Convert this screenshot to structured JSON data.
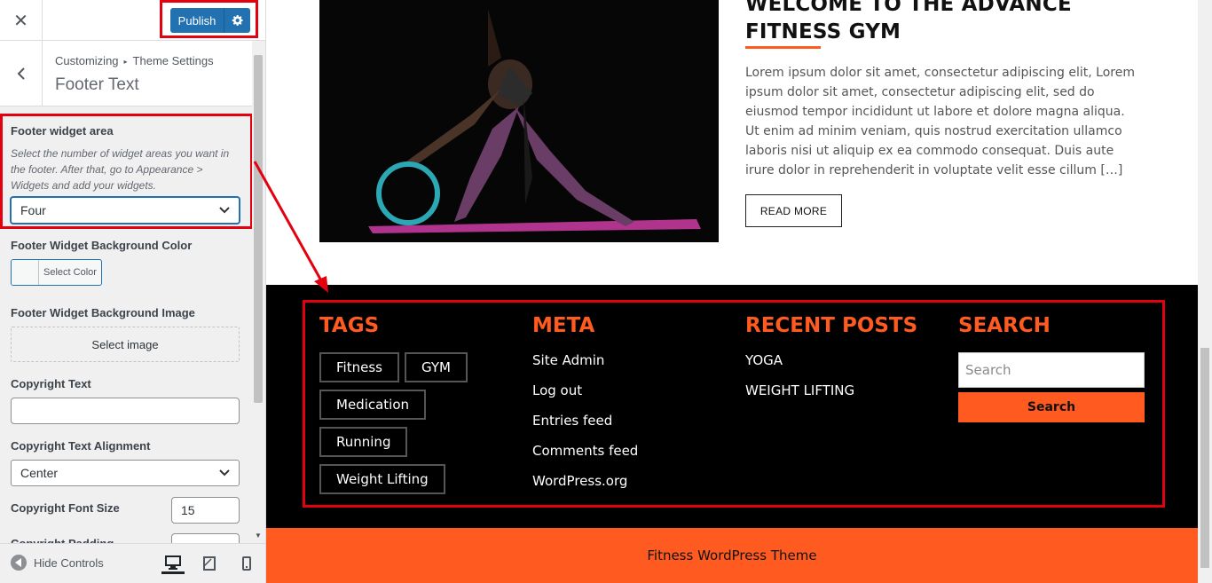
{
  "topbar": {
    "close_icon": "close-icon",
    "publish_label": "Publish",
    "publish_menu_icon": "gear-icon"
  },
  "section": {
    "breadcrumb_parent": "Customizing",
    "breadcrumb_child": "Theme Settings",
    "title": "Footer Text"
  },
  "controls": {
    "widget_area_label": "Footer widget area",
    "widget_area_desc": "Select the number of widget areas you want in the footer. After that, go to Appearance > Widgets and add your widgets.",
    "widget_area_value": "Four",
    "bg_color_label": "Footer Widget Background Color",
    "bg_color_button": "Select Color",
    "bg_image_label": "Footer Widget Background Image",
    "bg_image_button": "Select image",
    "copyright_text_label": "Copyright Text",
    "copyright_text_value": "",
    "copyright_align_label": "Copyright Text Alignment",
    "copyright_align_value": "Center",
    "copyright_font_label": "Copyright Font Size",
    "copyright_font_value": "15",
    "copyright_padding_label": "Copyright Padding"
  },
  "bottombar": {
    "hide_controls": "Hide Controls"
  },
  "post": {
    "title": "WELCOME TO THE ADVANCE FITNESS GYM",
    "excerpt": "Lorem ipsum dolor sit amet, consectetur adipiscing elit, Lorem ipsum dolor sit amet, consectetur adipiscing elit, sed do eiusmod tempor incididunt ut labore et dolore magna aliqua. Ut enim ad minim veniam, quis nostrud exercitation ullamco laboris nisi ut aliquip ex ea commodo consequat. Duis aute irure dolor in reprehenderit in voluptate velit esse cillum […]",
    "read_more": "READ MORE"
  },
  "footer": {
    "tags_title": "TAGS",
    "tags": [
      "Fitness",
      "GYM",
      "Medication",
      "Running",
      "Weight Lifting"
    ],
    "meta_title": "META",
    "meta_links": [
      "Site Admin",
      "Log out",
      "Entries feed",
      "Comments feed",
      "WordPress.org"
    ],
    "recent_title": "RECENT POSTS",
    "recent_posts": [
      "YOGA",
      "WEIGHT LIFTING"
    ],
    "search_title": "SEARCH",
    "search_placeholder": "Search",
    "search_button": "Search",
    "copyright": "Fitness WordPress Theme"
  },
  "colors": {
    "accent": "#ff5a1f",
    "wp_blue": "#2271b1",
    "annotation": "#e3000f",
    "footer_bg": "#000000"
  }
}
